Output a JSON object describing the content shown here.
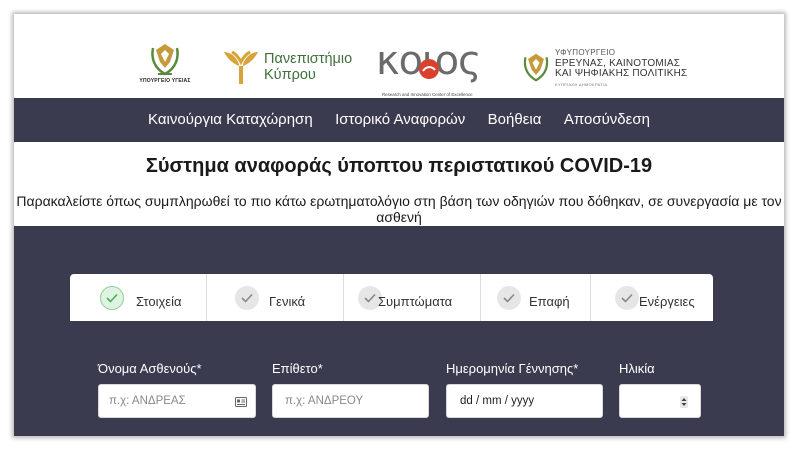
{
  "logos": {
    "moh_caption": "ΥΠΟΥΡΓΕΙΟ ΥΓΕΙΑΣ",
    "ucy_line1": "Πανεπιστήμιο",
    "ucy_line2": "Κύπρου",
    "koios_word": "κοιος",
    "koios_subtitle": "Research and Innovation Center of Excellence",
    "mrii_line1": "ΥΦΥΠΟΥΡΓΕΙΟ",
    "mrii_line2": "ΕΡΕΥΝΑΣ, ΚΑΙΝΟΤΟΜΙΑΣ",
    "mrii_line3": "ΚΑΙ ΨΗΦΙΑΚΗΣ ΠΟΛΙΤΙΚΗΣ",
    "mrii_line4": "ΚΥΠΡΙΑΚΗ ΔΗΜΟΚΡΑΤΙΑ"
  },
  "nav": {
    "items": [
      "Καινούργια Καταχώρηση",
      "Ιστορικό Αναφορών",
      "Βοήθεια",
      "Αποσύνδεση"
    ]
  },
  "page": {
    "title": "Σύστημα αναφοράς ύποπτου περιστατικού COVID-19",
    "instructions": "Παρακαλείστε όπως συμπληρωθεί το πιο κάτω ερωτηματολόγιο στη βάση των οδηγιών που δόθηκαν, σε συνεργασία με τον ασθενή"
  },
  "steps": [
    {
      "label": "Στοιχεία",
      "active": true
    },
    {
      "label": "Γενικά",
      "active": false
    },
    {
      "label": "Συμπτώματα",
      "active": false
    },
    {
      "label": "Επαφή",
      "active": false
    },
    {
      "label": "Ενέργειες",
      "active": false
    }
  ],
  "form": {
    "first_name": {
      "label": "Όνομα Ασθενούς*",
      "placeholder": "π.χ: ΑΝΔΡΕΑΣ"
    },
    "last_name": {
      "label": "Επίθετο*",
      "placeholder": "π.χ: ΑΝΔΡΕΟΥ"
    },
    "dob": {
      "label": "Ημερομηνία Γέννησης*",
      "placeholder": "dd / mm / yyyy"
    },
    "age": {
      "label": "Ηλικία",
      "value": ""
    }
  },
  "colors": {
    "nav_bg": "#3b3b50",
    "active_check": "#dff3e2",
    "ucy_green": "#3f6f3a",
    "emblem_gold": "#c49a3a"
  }
}
